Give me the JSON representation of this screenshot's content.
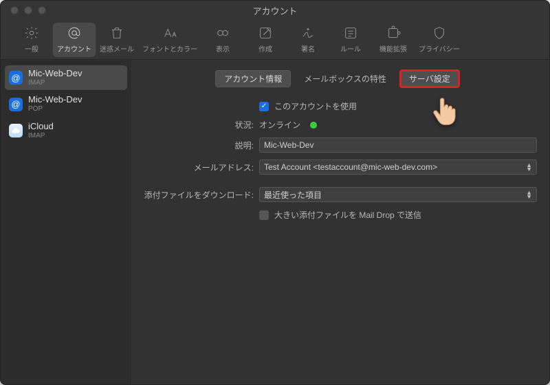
{
  "window_title": "アカウント",
  "toolbar": {
    "items": [
      {
        "label": "一般"
      },
      {
        "label": "アカウント"
      },
      {
        "label": "迷惑メール"
      },
      {
        "label": "フォントとカラー"
      },
      {
        "label": "表示"
      },
      {
        "label": "作成"
      },
      {
        "label": "署名"
      },
      {
        "label": "ルール"
      },
      {
        "label": "機能拡張"
      },
      {
        "label": "プライバシー"
      }
    ]
  },
  "sidebar": {
    "accounts": [
      {
        "name": "Mic-Web-Dev",
        "type": "IMAP"
      },
      {
        "name": "Mic-Web-Dev",
        "type": "POP"
      },
      {
        "name": "iCloud",
        "type": "IMAP"
      }
    ]
  },
  "tabs": {
    "info": "アカウント情報",
    "mailbox": "メールボックスの特性",
    "server": "サーバ設定"
  },
  "form": {
    "use_account_label": "このアカウントを使用",
    "status_label": "状況:",
    "status_value": "オンライン",
    "desc_label": "説明:",
    "desc_value": "Mic-Web-Dev",
    "email_label": "メールアドレス:",
    "email_value": "Test Account <testaccount@mic-web-dev.com>",
    "download_label": "添付ファイルをダウンロード:",
    "download_value": "最近使った項目",
    "maildrop_label": "大きい添付ファイルを Mail Drop で送信"
  }
}
